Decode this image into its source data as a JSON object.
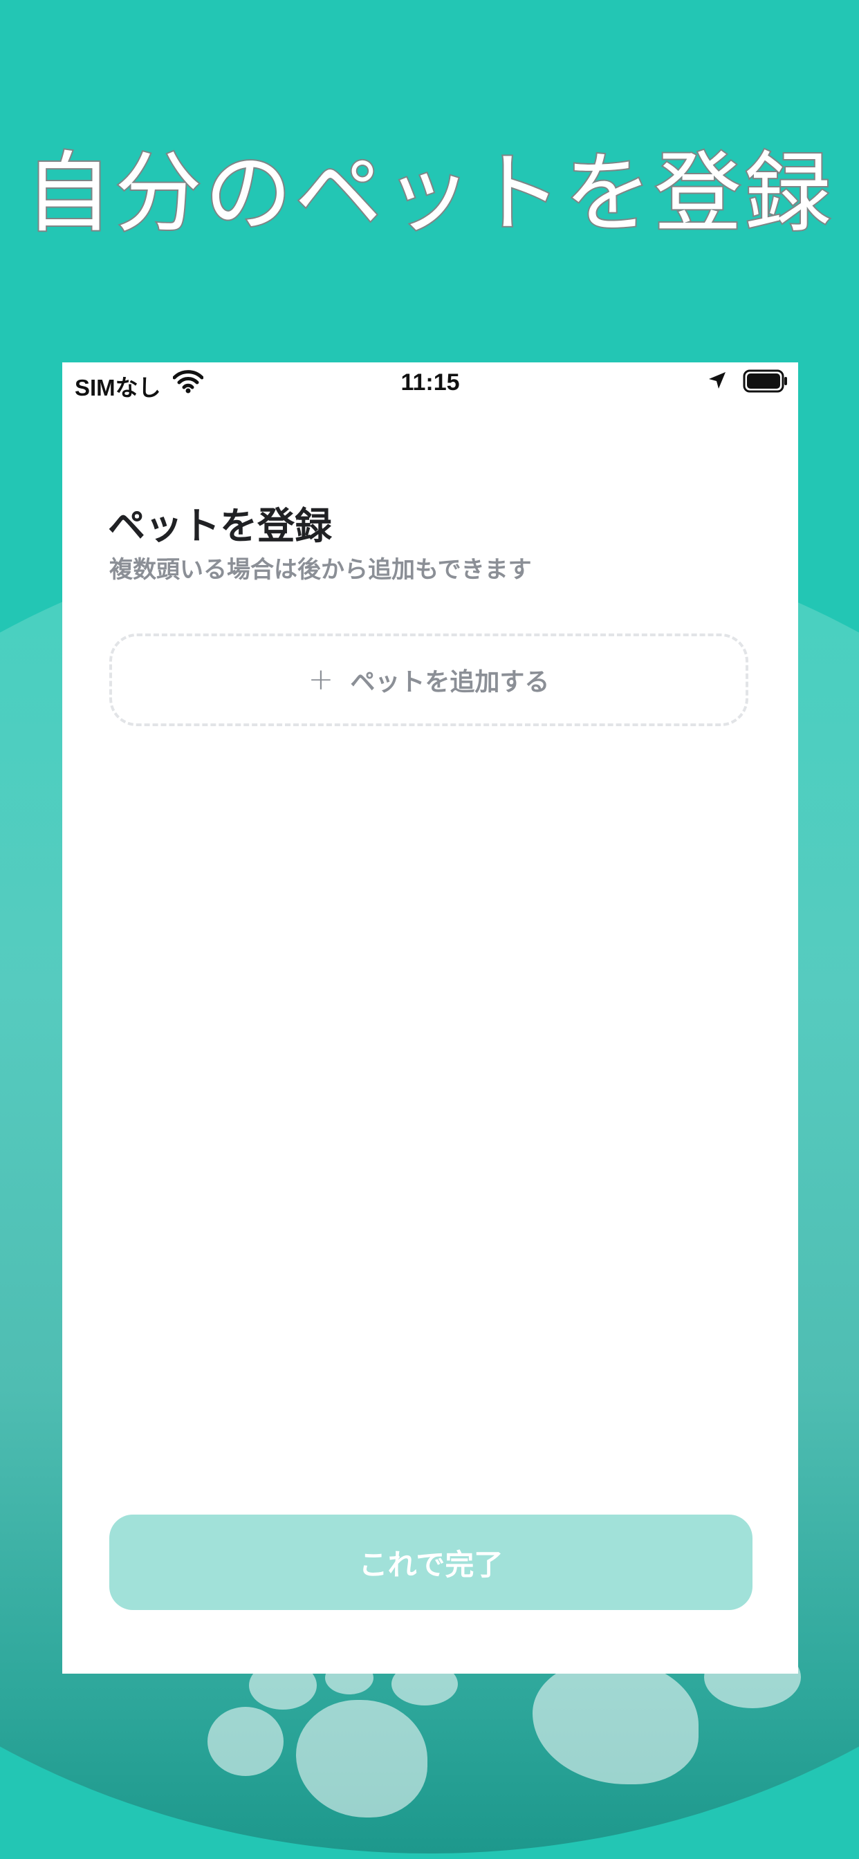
{
  "marketing": {
    "headline": "自分のペットを登録"
  },
  "status_bar": {
    "carrier": "SIMなし",
    "time": "11:15",
    "icons": [
      "wifi-icon",
      "location-arrow-icon",
      "battery-icon"
    ]
  },
  "screen": {
    "title": "ペットを登録",
    "subtitle": "複数頭いる場合は後から追加もできます",
    "add_pet": {
      "icon": "plus-icon",
      "label": "ペットを追加する"
    },
    "done_button": {
      "label": "これで完了"
    }
  },
  "colors": {
    "background": "#23c6b4",
    "done_button": "#a1e1d9",
    "title_text": "#202124",
    "secondary_text": "#8b8f96",
    "dashed_border": "#e2e4e7"
  }
}
